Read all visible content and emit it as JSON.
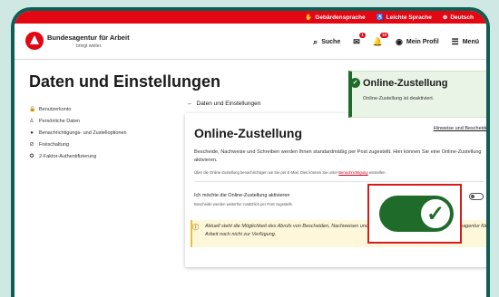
{
  "colors": {
    "brand_red": "#e30613",
    "frame_teal": "#0f5e54",
    "toggle_green": "#1f6b2a",
    "highlight_red": "#d71c1c"
  },
  "topbar": {
    "items": [
      {
        "icon": "sign-language-icon",
        "label": "Gebärdensprache"
      },
      {
        "icon": "easy-language-icon",
        "label": "Leichte Sprache"
      },
      {
        "icon": "globe-icon",
        "label": "Deutsch"
      }
    ]
  },
  "header": {
    "brand_name": "Bundesagentur für Arbeit",
    "slogan": "bringt weiter.",
    "search_label": "Suche",
    "mail_badge": "1",
    "notification_badge": "10",
    "profile_label": "Mein Profil",
    "menu_label": "Menü"
  },
  "page": {
    "title": "Daten und Einstellungen"
  },
  "sidebar": {
    "items": [
      {
        "icon": "lock-icon",
        "label": "Benutzerkonto"
      },
      {
        "icon": "person-icon",
        "label": "Persönliche Daten"
      },
      {
        "icon": "bell-icon",
        "label": "Benachrichtigungs- und Zustelloptionen"
      },
      {
        "icon": "link-icon",
        "label": "Freischaltung"
      },
      {
        "icon": "shield-icon",
        "label": "2-Faktor-Authentifizierung"
      }
    ]
  },
  "main": {
    "back_label": "Daten und Einstellungen",
    "card_link": "Hinweise und Bescheide",
    "card_title": "Online-Zustellung",
    "description": "Bescheide, Nachweise und Schreiben werden Ihnen standardmäßig per Post zugestellt. Hier können Sie eine Online-Zustellung aktivieren.",
    "sub_text": "Über die Online-Zustellung benachrichtigen wir Sie per E-Mail. Dies können Sie unter",
    "sub_link": "Benachrichtigung",
    "sub_text_end": "einstellen.",
    "toggle_label": "Ich möchte die Online-Zustellung aktivieren",
    "toggle_hint": "Bescheide werden weiterhin zusätzlich per Post zugestellt.",
    "info_text": "Aktuell steht die Möglichkeit des Abrufs von Bescheiden, Nachweisen und Schreiben nur über das Portal der Bundesagentur für Arbeit noch nicht zur Verfügung."
  },
  "toast": {
    "title": "Online-Zustellung",
    "message": "Online-Zustellung ist deaktiviert.",
    "close_label": "×"
  }
}
